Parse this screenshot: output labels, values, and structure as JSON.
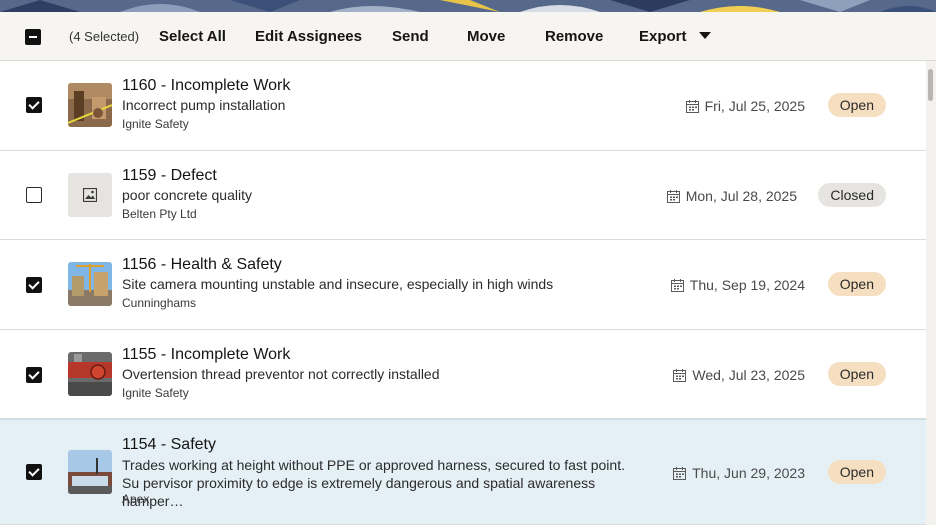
{
  "toolbar": {
    "selected_count": "(4 Selected)",
    "select_all": "Select All",
    "edit_assignees": "Edit Assignees",
    "send": "Send",
    "move": "Move",
    "remove": "Remove",
    "export": "Export"
  },
  "items": [
    {
      "title": "1160 - Incomplete Work",
      "description": "Incorrect pump installation",
      "company": "Ignite Safety",
      "date": "Fri, Jul 25, 2025",
      "status": "Open",
      "checked": true,
      "thumbnail": "site-photo"
    },
    {
      "title": "1159 - Defect",
      "description": "poor concrete quality",
      "company": "Belten Pty Ltd",
      "date": "Mon, Jul 28, 2025",
      "status": "Closed",
      "checked": false,
      "thumbnail": "image-placeholder-icon"
    },
    {
      "title": "1156 - Health & Safety",
      "description": "Site camera mounting unstable and insecure, especially in high winds",
      "company": "Cunninghams",
      "date": "Thu, Sep 19, 2024",
      "status": "Open",
      "checked": true,
      "thumbnail": "site-photo"
    },
    {
      "title": "1155 - Incomplete Work",
      "description": "Overtension thread preventor not correctly installed",
      "company": "Ignite Safety",
      "date": "Wed, Jul 23, 2025",
      "status": "Open",
      "checked": true,
      "thumbnail": "site-photo"
    },
    {
      "title": "1154 - Safety",
      "description": "Trades working at height without PPE or approved harness, secured to fast point. Su pervisor proximity to edge is extremely dangerous and spatial awareness hamper…",
      "company": "Apex",
      "date": "Thu, Jun 29, 2023",
      "status": "Open",
      "checked": true,
      "thumbnail": "site-photo"
    }
  ],
  "colors": {
    "open_badge": "#f6dfc0",
    "closed_badge": "#e6e4e0",
    "selected_row": "#e4f0f6",
    "toolbar_bg": "#f6f5f2"
  }
}
